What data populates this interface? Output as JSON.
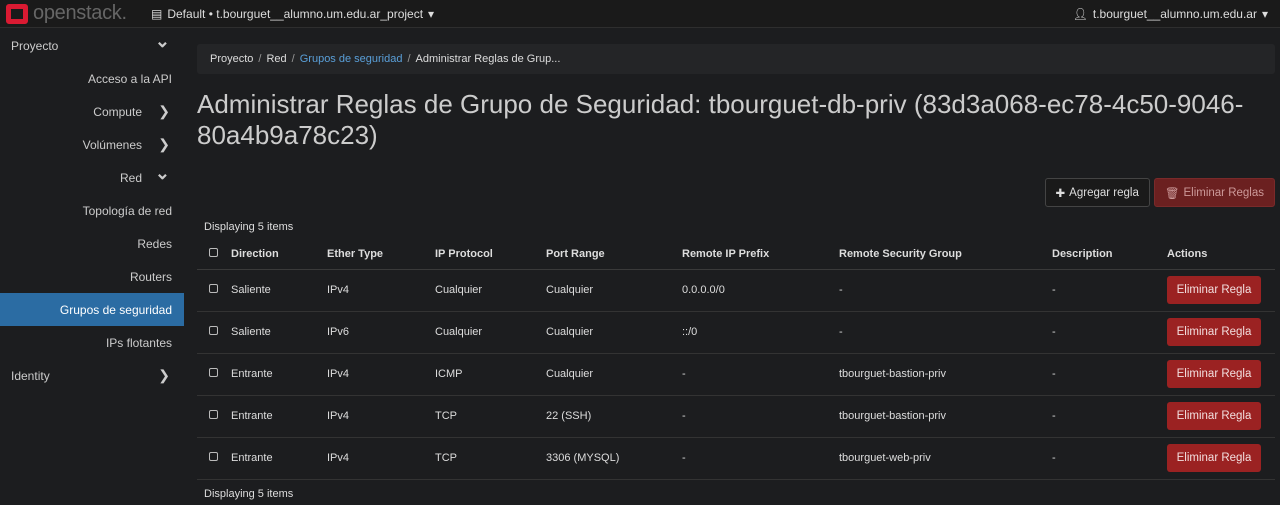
{
  "brand": {
    "name": "openstack."
  },
  "topbar": {
    "project": "Default • t.bourguet__alumno.um.edu.ar_project",
    "user": "t.bourguet__alumno.um.edu.ar"
  },
  "sidebar": {
    "items": [
      {
        "label": "Proyecto",
        "type": "section",
        "icon": "chevron-down"
      },
      {
        "label": "Acceso a la API",
        "type": "leaf"
      },
      {
        "label": "Compute",
        "type": "sub",
        "icon": "chevron-right"
      },
      {
        "label": "Volúmenes",
        "type": "sub",
        "icon": "chevron-right"
      },
      {
        "label": "Red",
        "type": "sub",
        "icon": "chevron-down"
      },
      {
        "label": "Topología de red",
        "type": "leaf"
      },
      {
        "label": "Redes",
        "type": "leaf"
      },
      {
        "label": "Routers",
        "type": "leaf"
      },
      {
        "label": "Grupos de seguridad",
        "type": "leaf",
        "active": true
      },
      {
        "label": "IPs flotantes",
        "type": "leaf"
      },
      {
        "label": "Identity",
        "type": "section",
        "icon": "chevron-right"
      }
    ]
  },
  "breadcrumb": [
    "Proyecto",
    "Red",
    "Grupos de seguridad",
    "Administrar Reglas de Grup..."
  ],
  "title": "Administrar Reglas de Grupo de Seguridad: tbourguet-db-priv (83d3a068-ec78-4c50-9046-80a4b9a78c23)",
  "buttons": {
    "add": "Agregar regla",
    "delete_all": "Eliminar Reglas"
  },
  "table": {
    "count": "Displaying 5 items",
    "headers": [
      "Direction",
      "Ether Type",
      "IP Protocol",
      "Port Range",
      "Remote IP Prefix",
      "Remote Security Group",
      "Description",
      "Actions"
    ],
    "rows": [
      [
        "Saliente",
        "IPv4",
        "Cualquier",
        "Cualquier",
        "0.0.0.0/0",
        "-",
        "-"
      ],
      [
        "Saliente",
        "IPv6",
        "Cualquier",
        "Cualquier",
        "::/0",
        "-",
        "-"
      ],
      [
        "Entrante",
        "IPv4",
        "ICMP",
        "Cualquier",
        "-",
        "tbourguet-bastion-priv",
        "-"
      ],
      [
        "Entrante",
        "IPv4",
        "TCP",
        "22 (SSH)",
        "-",
        "tbourguet-bastion-priv",
        "-"
      ],
      [
        "Entrante",
        "IPv4",
        "TCP",
        "3306 (MYSQL)",
        "-",
        "tbourguet-web-priv",
        "-"
      ]
    ],
    "row_action": "Eliminar Regla"
  }
}
